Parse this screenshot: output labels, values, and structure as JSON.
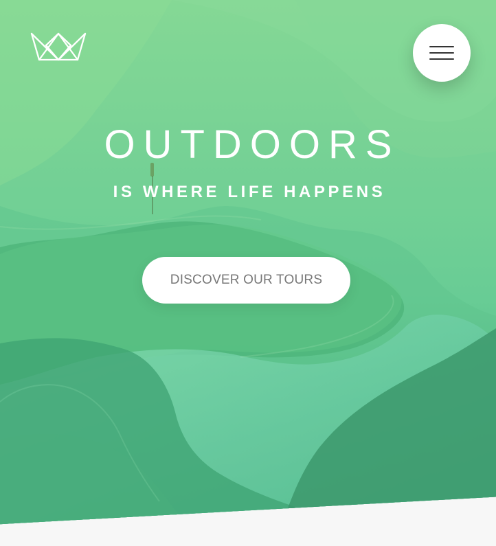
{
  "hero": {
    "title": "OUTDOORS",
    "subtitle": "IS WHERE LIFE HAPPENS",
    "cta_label": "DISCOVER OUR TOURS"
  },
  "icons": {
    "logo": "crown-logo-icon",
    "menu": "hamburger-menu-icon"
  },
  "colors": {
    "hero_top": "#7ad58b",
    "hero_mid": "#5bc88c",
    "hero_bottom": "#2f9f73",
    "button_bg": "#ffffff",
    "button_text": "#777777",
    "page_bg": "#f7f7f7"
  }
}
